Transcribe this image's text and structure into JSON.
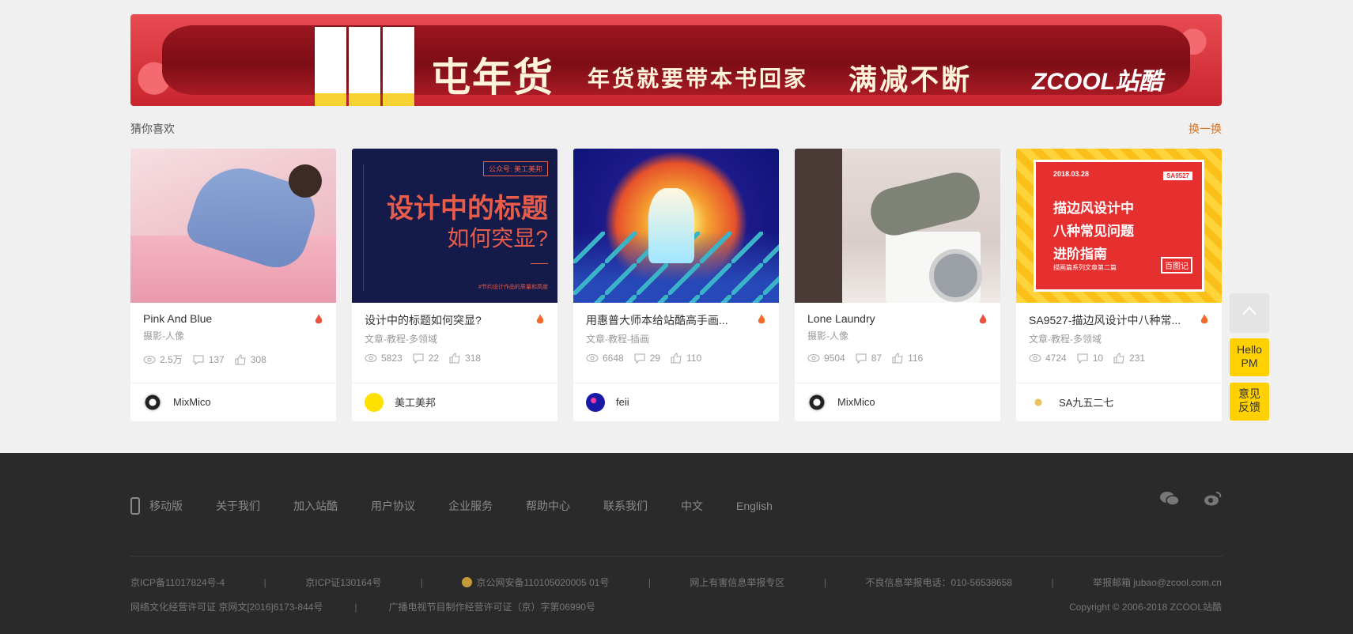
{
  "banner": {
    "title": "屯年货",
    "subtitle": "年货就要带本书回家",
    "promo": "满减不断",
    "brand": "ZCOOL站酷"
  },
  "section": {
    "title": "猜你喜欢",
    "refresh": "换一换"
  },
  "cards": [
    {
      "title": "Pink And Blue",
      "category": "摄影-人像",
      "views": "2.5万",
      "comments": "137",
      "likes": "308",
      "author": "MixMico",
      "hot_color": "#e8543f"
    },
    {
      "title": "设计中的标题如何突显?",
      "category": "文章-教程-多领域",
      "views": "5823",
      "comments": "22",
      "likes": "318",
      "author": "美工美邦",
      "hot_color": "#f16a2e",
      "thumb": {
        "badge": "公众号: 美工美邦",
        "line1": "设计中的标题",
        "line2": "如何突显?",
        "small": "#节约设计作品的质量和高度"
      }
    },
    {
      "title": "用惠普大师本给站酷高手画...",
      "category": "文章-教程-插画",
      "views": "6648",
      "comments": "29",
      "likes": "110",
      "author": "feii",
      "hot_color": "#f16a2e"
    },
    {
      "title": "Lone Laundry",
      "category": "摄影-人像",
      "views": "9504",
      "comments": "87",
      "likes": "116",
      "author": "MixMico",
      "hot_color": "#e8543f"
    },
    {
      "title": "SA9527-描边风设计中八种常...",
      "category": "文章-教程-多领域",
      "views": "4724",
      "comments": "10",
      "likes": "231",
      "author": "SA九五二七",
      "hot_color": "#f16a2e",
      "thumb": {
        "date": "2018.03.28",
        "tag": "SA9527",
        "line1": "描边风设计中",
        "line2": "八种常见问题",
        "line3": "进阶指南",
        "sub": "描画篇系列文章第二篇",
        "stamp": "百图记"
      }
    }
  ],
  "tools": {
    "hello": [
      "Hello",
      "PM"
    ],
    "feedback": [
      "意见",
      "反馈"
    ]
  },
  "footer": {
    "nav": [
      "移动版",
      "关于我们",
      "加入站酷",
      "用户协议",
      "企业服务",
      "帮助中心",
      "联系我们",
      "中文",
      "English"
    ],
    "row1": [
      "京ICP备11017824号-4",
      "京ICP证130164号",
      "京公网安备110105020005 01号",
      "网上有害信息举报专区",
      "不良信息举报电话：010-56538658",
      "举报邮箱 jubao@zcool.com.cn"
    ],
    "row2_left": [
      "网络文化经营许可证 京网文[2016]6173-844号",
      "广播电视节目制作经营许可证（京）字第06990号"
    ],
    "copyright": "Copyright © 2006-2018 ZCOOL站酷"
  }
}
